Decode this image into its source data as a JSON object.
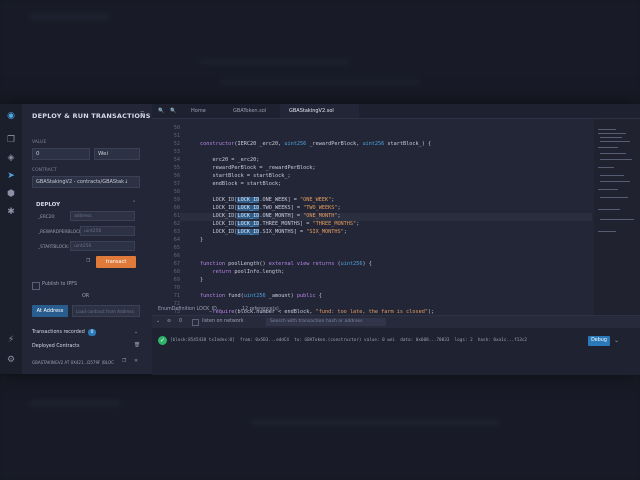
{
  "panel": {
    "title": "DEPLOY & RUN TRANSACTIONS",
    "value_label": "VALUE",
    "value": "0",
    "unit": "Wei",
    "contract_label": "CONTRACT",
    "contract": "GBAStakingV2 - contracts/GBAStak↓",
    "deploy_label": "DEPLOY",
    "param1_label": "_ERC20:",
    "param1_placeholder": "address",
    "param2_label": "_REWARDPERBLOCK:",
    "param2_placeholder": "uint256",
    "param3_label": "_STARTBLOCK:",
    "param3_placeholder": "uint256",
    "transact": "transact",
    "publish": "Publish to IPFS",
    "or": "OR",
    "at_address": "At Address",
    "load_contract": "Load contract from Address",
    "transactions": "Transactions recorded",
    "tx_count": "0",
    "deployed": "Deployed Contracts",
    "deployed_item": "GBASTAKINGV2 AT 0X421...D579F (BLOC"
  },
  "tabs": [
    {
      "label": "Home"
    },
    {
      "label": "GBAToken.sol"
    },
    {
      "label": "GBAStakingV2.sol"
    }
  ],
  "editor": {
    "line_numbers": [
      "50",
      "51",
      "52",
      "53",
      "54",
      "55",
      "56",
      "57",
      "58",
      "59",
      "60",
      "61",
      "62",
      "63",
      "64",
      "65",
      "66",
      "67",
      "68",
      "69",
      "70",
      "71",
      "72",
      "73",
      "74"
    ],
    "status": "EnumDefinition LOCK_ID...",
    "references": "12 reference(s)"
  },
  "terminal": {
    "listen": "listen on network",
    "search_placeholder": "Search with transaction hash or address",
    "log": "[block:8545438 txIndex:0]  from: 0x5B3...eddC4  to: GBAToken.(constructor) value: 0 wei  data: 0x608...70033  logs: 2  hash: 0xa1c...f13c2",
    "debug": "Debug"
  },
  "colors": {
    "accent": "#4fa3e0",
    "transact": "#e07a3b",
    "success": "#2fb36a"
  }
}
